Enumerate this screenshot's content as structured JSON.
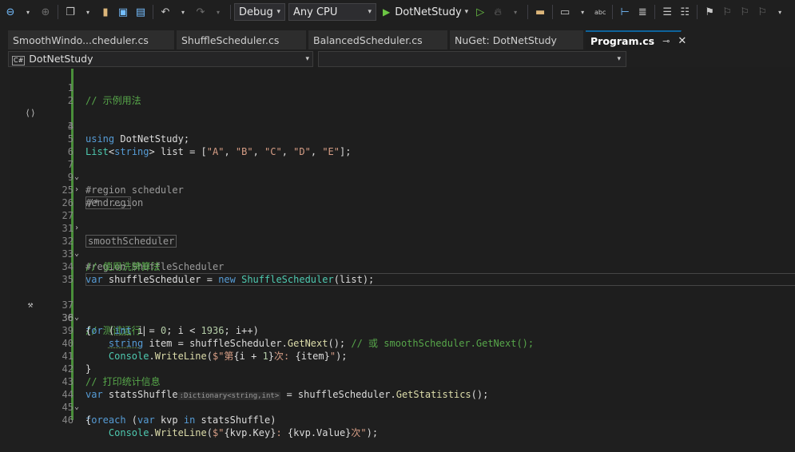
{
  "toolbar": {
    "configuration": "Debug",
    "platform": "Any CPU",
    "run_target": "DotNetStudy",
    "icons": [
      "back-icon",
      "forward-icon",
      "new-item-icon",
      "open-folder-icon",
      "save-icon",
      "save-all-icon",
      "undo-icon",
      "redo-icon",
      "start-without-debug-icon",
      "hot-reload-icon",
      "solution-explorer-icon",
      "window-layout-icon",
      "spell-check-icon",
      "breakpoint-icon",
      "comment-icon",
      "uncomment-icon",
      "bookmark-icon",
      "bookmark-prev-icon",
      "bookmark-next-icon",
      "bookmark-clear-icon"
    ]
  },
  "tabs": [
    {
      "label": "SmoothWindo...cheduler.cs"
    },
    {
      "label": "ShuffleScheduler.cs"
    },
    {
      "label": "BalancedScheduler.cs"
    },
    {
      "label": "NuGet: DotNetStudy"
    },
    {
      "label": "Program.cs"
    }
  ],
  "navbar": {
    "project": "DotNetStudy",
    "member": ""
  },
  "editor": {
    "current_line": "36",
    "lines": [
      {
        "num": "1",
        "text": "// 示例用法"
      },
      {
        "num": "2",
        "text": ""
      },
      {
        "num": "3",
        "text": "using DotNetStudy;"
      },
      {
        "num": "4",
        "text": ""
      },
      {
        "num": "5",
        "text": "List<string> list = [\"A\", \"B\", \"C\", \"D\", \"E\"];"
      },
      {
        "num": "6",
        "text": ""
      },
      {
        "num": "7",
        "text": "#region scheduler"
      },
      {
        "num": "9",
        "text": "/*  ..."
      },
      {
        "num": "25",
        "text": "#endregion"
      },
      {
        "num": "26",
        "text": ""
      },
      {
        "num": "27",
        "text": "smoothScheduler"
      },
      {
        "num": "31",
        "text": ""
      },
      {
        "num": "32",
        "text": "#region ShuffleScheduler"
      },
      {
        "num": "33",
        "text": "// 使用洗牌算法"
      },
      {
        "num": "34",
        "text": "var shuffleScheduler = new ShuffleScheduler(list);"
      },
      {
        "num": "35",
        "text": ""
      },
      {
        "num": "36",
        "text": "// 测试运行"
      },
      {
        "num": "37",
        "text": "for (int i = 0; i < 1936; i++)"
      },
      {
        "num": "38",
        "text": "{"
      },
      {
        "num": "39",
        "text": "string item = shuffleScheduler.GetNext(); // 或 smoothScheduler.GetNext();"
      },
      {
        "num": "40",
        "text": "Console.WriteLine($\"第{i + 1}次: {item}\");"
      },
      {
        "num": "41",
        "text": "}"
      },
      {
        "num": "42",
        "text": "// 打印统计信息"
      },
      {
        "num": "43",
        "text": "var statsShuffle:Dictionary<string,int> = shuffleScheduler.GetStatistics();"
      },
      {
        "num": "44",
        "text": "foreach (var kvp in statsShuffle)"
      },
      {
        "num": "45",
        "text": "{"
      },
      {
        "num": "46",
        "text": "Console.WriteLine($\"{kvp.Key}: {kvp.Value}次\");"
      }
    ]
  },
  "colors": {
    "keyword": "#569cd6",
    "comment": "#57a64a",
    "type": "#4ec9b0",
    "string": "#d69d85",
    "method": "#dcdcaa",
    "accent": "#0e639c"
  }
}
